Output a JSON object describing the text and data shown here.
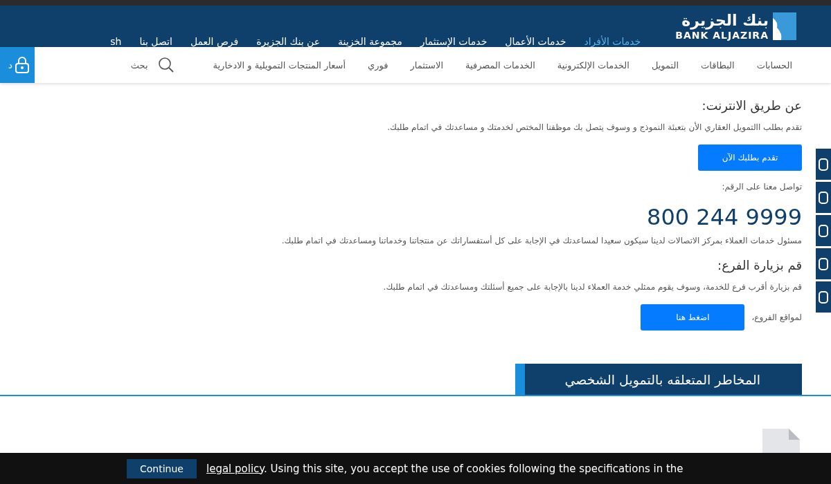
{
  "header": {
    "logo": {
      "arabic": "بنك الجزيرة",
      "latin": "BANK ALJAZIRA"
    },
    "nav": [
      {
        "label": "خدمات الأفراد",
        "selected": true
      },
      {
        "label": "خدمات الأعمال",
        "selected": false
      },
      {
        "label": "خدمات الإستثمار",
        "selected": false
      },
      {
        "label": "مجموعة الخزينة",
        "selected": false
      },
      {
        "label": "عن بنك الجزيرة",
        "selected": false
      },
      {
        "label": "فرص العمل",
        "selected": false
      },
      {
        "label": "اتصل بنا",
        "selected": false
      },
      {
        "label": "sh",
        "selected": false
      }
    ]
  },
  "subnav": {
    "items": [
      "الحسابات",
      "البطاقات",
      "التمويل",
      "الخدمات الإلكترونية",
      "الخدمات المصرفية",
      "الاستثمار",
      "فوري",
      "أسعار المنتجات التمويلية و الادخارية"
    ],
    "search": "بحث",
    "login": "د"
  },
  "content": [
    {
      "kind": "heading",
      "text": "عن طريق الانترنت:"
    },
    {
      "kind": "paragraph",
      "text": "تقدم بطلب االتمويل العقاري الأن بتعبئة النموذج و وسوف يتصل بك موظفنا المختص لخدمتك و مساعدتك في اتمام طلبك."
    },
    {
      "kind": "button",
      "text": "تقدم بطلبك الآن"
    },
    {
      "kind": "paragraph",
      "text": "تواصل معنا على الرقم:"
    },
    {
      "kind": "phone",
      "text": "800 244 9999"
    },
    {
      "kind": "paragraph",
      "text": "مسئول خدمات العملاء بمركز الاتصالات لدينا سيكون سعيدا لمساعدتك في الإجابة على كل أستفساراتك عن منتجاتنا وخدماتنا ومساعدتك في اتمام طلبك."
    },
    {
      "kind": "heading",
      "text": "قم بزيارة الفرع:"
    },
    {
      "kind": "paragraph",
      "text": "قم بزيارة أقرب فرع للخدمة، وسوف يقوم ممثلي خدمة العملاء لدينا بالإجابة على جميع أسئلتك ومساعدتك في اتمام طلبك."
    },
    {
      "kind": "labeled-button",
      "label": "لمواقع الفروع،",
      "text": "اضغط هنا"
    }
  ],
  "section": {
    "title": "المخاطر المتعلقه بالتمويل الشخصي"
  },
  "cookie_bar": {
    "button": "Continue",
    "link": "legal policy",
    "text": ". Using this site, you accept the use of cookies following the specifications in the"
  }
}
